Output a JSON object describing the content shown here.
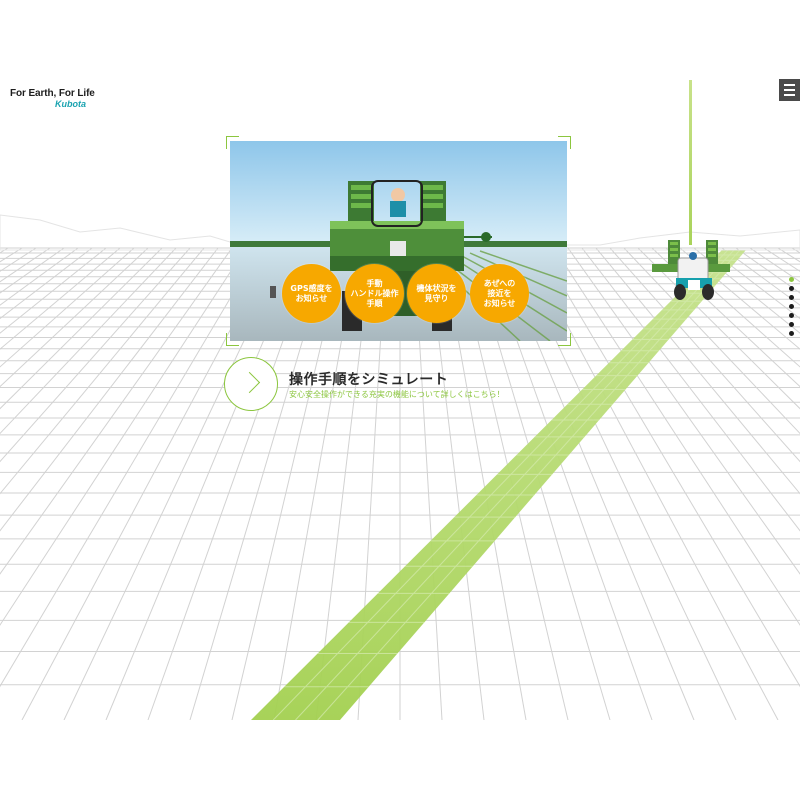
{
  "brand": {
    "tagline": "For Earth, For Life",
    "logo_text": "Kubota",
    "logo_color": "#1aa3b0"
  },
  "header": {
    "menu_icon": "hamburger-menu-icon"
  },
  "hero": {
    "features": [
      {
        "label": "GPS感度を\nお知らせ"
      },
      {
        "label": "手動\nハンドル操作\n手順"
      },
      {
        "label": "機体状況を\n見守り"
      },
      {
        "label": "あぜへの\n接近を\nお知らせ"
      }
    ],
    "cta": {
      "title": "操作手順をシミュレート",
      "subtitle": "安心安全操作ができる充実の機能について詳しくはこちら！",
      "icon": "chevron-right-icon"
    }
  },
  "pagination": {
    "count": 7,
    "active_index": 0
  },
  "colors": {
    "accent_green": "#8cc63f",
    "feature_orange": "#f7a800",
    "menu_bg": "#4a4a4a"
  }
}
